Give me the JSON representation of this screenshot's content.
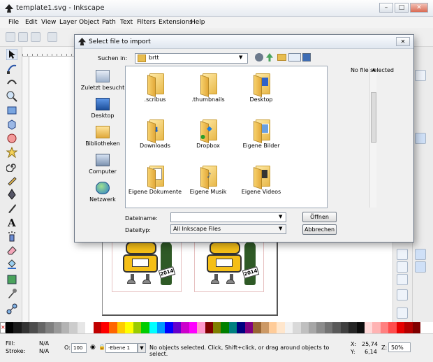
{
  "window": {
    "title": "template1.svg - Inkscape",
    "min": "–",
    "max": "□",
    "close": "✕"
  },
  "menu": [
    {
      "label": "File"
    },
    {
      "label": "Edit"
    },
    {
      "label": "View"
    },
    {
      "label": "Layer"
    },
    {
      "label": "Object"
    },
    {
      "label": "Path"
    },
    {
      "label": "Text"
    },
    {
      "label": "Filters"
    },
    {
      "label": "Extensions"
    },
    {
      "label": "Help"
    }
  ],
  "dialog": {
    "title": "Select file to import",
    "close": "✕",
    "look_in_label": "Suchen in:",
    "look_in_value": "brtt",
    "places": [
      {
        "label": "Zuletzt besucht",
        "icon": "recent-places-icon"
      },
      {
        "label": "Desktop",
        "icon": "desktop-icon"
      },
      {
        "label": "Bibliotheken",
        "icon": "libraries-icon"
      },
      {
        "label": "Computer",
        "icon": "computer-icon"
      },
      {
        "label": "Netzwerk",
        "icon": "network-icon"
      }
    ],
    "files": [
      {
        "name": ".scribus",
        "icon": "folder-icon"
      },
      {
        "name": ".thumbnails",
        "icon": "folder-icon"
      },
      {
        "name": "Desktop",
        "icon": "folder-desktop-icon"
      },
      {
        "name": "Downloads",
        "icon": "folder-downloads-icon"
      },
      {
        "name": "Dropbox",
        "icon": "folder-dropbox-icon"
      },
      {
        "name": "Eigene Bilder",
        "icon": "folder-pictures-icon"
      },
      {
        "name": "Eigene Dokumente",
        "icon": "folder-documents-icon"
      },
      {
        "name": "Eigene Musik",
        "icon": "folder-music-icon"
      },
      {
        "name": "Eigene Videos",
        "icon": "folder-videos-icon"
      }
    ],
    "preview_text": "No file selected",
    "filename_label": "Dateiname:",
    "filename_value": "",
    "filetype_label": "Dateityp:",
    "filetype_value": "All Inkscape Files",
    "open_button": "Öffnen",
    "cancel_button": "Abbrechen"
  },
  "canvas": {
    "badge_text": "2014"
  },
  "palette": [
    "#000000",
    "#1a1a1a",
    "#333333",
    "#4d4d4d",
    "#666666",
    "#808080",
    "#999999",
    "#b3b3b3",
    "#cccccc",
    "#e6e6e6",
    "#ffffff",
    "#c00000",
    "#ff0000",
    "#ff6600",
    "#ffcc00",
    "#ffff00",
    "#99cc00",
    "#00cc00",
    "#00ffff",
    "#0099ff",
    "#0000ff",
    "#6600cc",
    "#cc00cc",
    "#ff00ff",
    "#ff99cc",
    "#800000",
    "#808000",
    "#008000",
    "#008080",
    "#000080",
    "#800080",
    "#996633",
    "#cc9966",
    "#ffcc99",
    "#ffe6cc",
    "#f2f2f2",
    "#d9d9d9",
    "#bfbfbf",
    "#a6a6a6",
    "#8c8c8c",
    "#737373",
    "#595959",
    "#404040",
    "#262626",
    "#0d0d0d",
    "#ffd9d9",
    "#ffb3b3",
    "#ff8080",
    "#ff4d4d",
    "#e60000",
    "#b30000",
    "#800000"
  ],
  "status": {
    "fill_label": "Fill:",
    "fill_value": "N/A",
    "stroke_label": "Stroke:",
    "stroke_value": "N/A",
    "opacity_label": "O:",
    "opacity_value": "100",
    "layer_value": "-Ebene 1",
    "message": "No objects selected. Click, Shift+click, or drag around objects to select.",
    "x_label": "X:",
    "x_value": "25,74",
    "y_label": "Y:",
    "y_value": "6,14",
    "zoom_label": "Z:",
    "zoom_value": "50%"
  }
}
